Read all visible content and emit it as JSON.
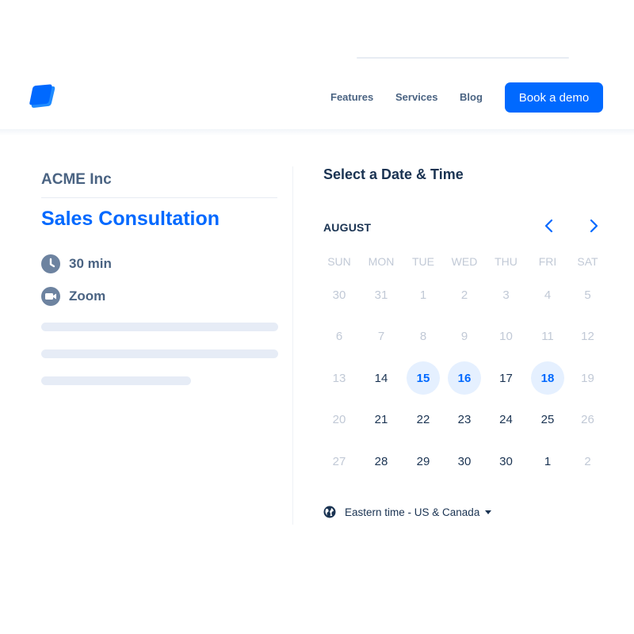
{
  "header": {
    "logo": "brand-logo",
    "nav": [
      {
        "label": "Features"
      },
      {
        "label": "Services"
      },
      {
        "label": "Blog"
      }
    ],
    "cta_label": "Book a demo"
  },
  "colors": {
    "brand": "#0069ff",
    "text_dark": "#1a3352",
    "text_muted": "#4a6382",
    "day_muted": "#c1c9d6",
    "available_bg": "#e5f0ff",
    "skeleton": "#e6ecf6"
  },
  "event": {
    "company": "ACME Inc",
    "title": "Sales Consultation",
    "duration": {
      "icon": "clock-icon",
      "label": "30 min"
    },
    "location": {
      "icon": "video-camera-icon",
      "label": "Zoom"
    },
    "description_placeholder_lines": 3
  },
  "calendar": {
    "title": "Select a Date & Time",
    "month": "AUGUST",
    "prev_icon": "chevron-left-icon",
    "next_icon": "chevron-right-icon",
    "weekdays": [
      "SUN",
      "MON",
      "TUE",
      "WED",
      "THU",
      "FRI",
      "SAT"
    ],
    "weeks": [
      [
        {
          "d": "30",
          "s": "muted"
        },
        {
          "d": "31",
          "s": "muted"
        },
        {
          "d": "1",
          "s": "muted"
        },
        {
          "d": "2",
          "s": "muted"
        },
        {
          "d": "3",
          "s": "muted"
        },
        {
          "d": "4",
          "s": "muted"
        },
        {
          "d": "5",
          "s": "muted"
        }
      ],
      [
        {
          "d": "6",
          "s": "muted"
        },
        {
          "d": "7",
          "s": "muted"
        },
        {
          "d": "8",
          "s": "muted"
        },
        {
          "d": "9",
          "s": "muted"
        },
        {
          "d": "10",
          "s": "muted"
        },
        {
          "d": "11",
          "s": "muted"
        },
        {
          "d": "12",
          "s": "muted"
        }
      ],
      [
        {
          "d": "13",
          "s": "muted"
        },
        {
          "d": "14",
          "s": "active"
        },
        {
          "d": "15",
          "s": "available"
        },
        {
          "d": "16",
          "s": "available"
        },
        {
          "d": "17",
          "s": "active"
        },
        {
          "d": "18",
          "s": "available"
        },
        {
          "d": "19",
          "s": "muted"
        }
      ],
      [
        {
          "d": "20",
          "s": "muted"
        },
        {
          "d": "21",
          "s": "active"
        },
        {
          "d": "22",
          "s": "active"
        },
        {
          "d": "23",
          "s": "active"
        },
        {
          "d": "24",
          "s": "active"
        },
        {
          "d": "25",
          "s": "active"
        },
        {
          "d": "26",
          "s": "muted"
        }
      ],
      [
        {
          "d": "27",
          "s": "muted"
        },
        {
          "d": "28",
          "s": "active"
        },
        {
          "d": "29",
          "s": "active"
        },
        {
          "d": "30",
          "s": "active"
        },
        {
          "d": "30",
          "s": "active"
        },
        {
          "d": "1",
          "s": "active"
        },
        {
          "d": "2",
          "s": "muted"
        }
      ]
    ],
    "timezone": {
      "icon": "globe-icon",
      "label": "Eastern time - US & Canada"
    }
  }
}
